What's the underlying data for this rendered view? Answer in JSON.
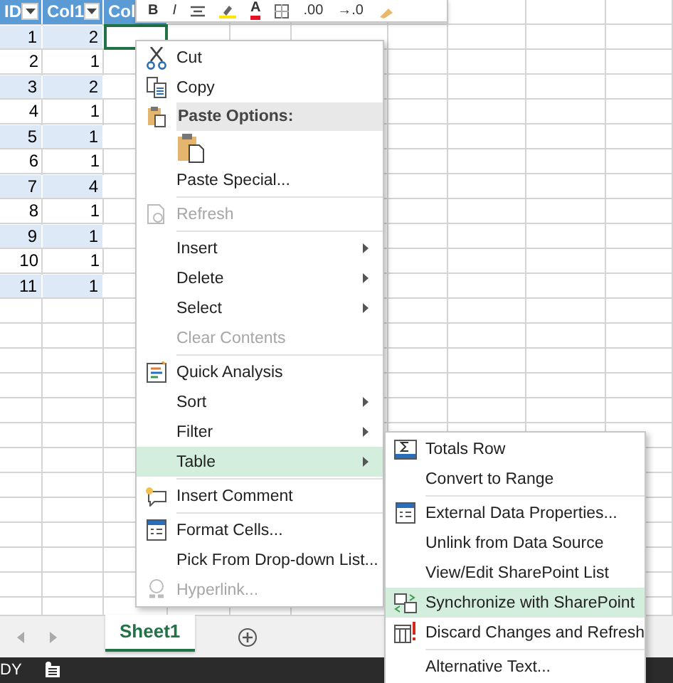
{
  "toolbar": [
    {
      "kind": "text",
      "text": "B"
    },
    {
      "kind": "text",
      "text": "I"
    },
    {
      "kind": "icon"
    },
    {
      "kind": "icon"
    },
    {
      "kind": "color-text",
      "text": "A"
    },
    {
      "kind": "icon"
    },
    {
      "kind": "text",
      "text": ".00"
    },
    {
      "kind": "text",
      "text": "→.0"
    },
    {
      "kind": "icon"
    }
  ],
  "table": {
    "columns": [
      {
        "label": "ID",
        "filter": true
      },
      {
        "label": "Col1",
        "filter": true
      },
      {
        "label": "Col"
      }
    ],
    "rows": [
      [
        "1",
        "2"
      ],
      [
        "2",
        "1"
      ],
      [
        "3",
        "2"
      ],
      [
        "4",
        "1"
      ],
      [
        "5",
        "1"
      ],
      [
        "6",
        "1"
      ],
      [
        "7",
        "4"
      ],
      [
        "8",
        "1"
      ],
      [
        "9",
        "1"
      ],
      [
        "10",
        "1"
      ],
      [
        "11",
        "1"
      ]
    ]
  },
  "context_menu": [
    {
      "kind": "item",
      "label": "Cut",
      "disabled": false,
      "submenu": false,
      "selected": false
    },
    {
      "kind": "item",
      "label": "Copy",
      "disabled": false,
      "submenu": false,
      "selected": false
    },
    {
      "kind": "header",
      "label": "Paste Options:"
    },
    {
      "kind": "paste-option"
    },
    {
      "kind": "item",
      "label": "Paste Special...",
      "disabled": false,
      "submenu": false,
      "selected": false
    },
    {
      "kind": "separator"
    },
    {
      "kind": "item",
      "label": "Refresh",
      "disabled": true,
      "submenu": false,
      "selected": false
    },
    {
      "kind": "separator"
    },
    {
      "kind": "item",
      "label": "Insert",
      "disabled": false,
      "submenu": true,
      "selected": false
    },
    {
      "kind": "item",
      "label": "Delete",
      "disabled": false,
      "submenu": true,
      "selected": false
    },
    {
      "kind": "item",
      "label": "Select",
      "disabled": false,
      "submenu": true,
      "selected": false
    },
    {
      "kind": "item",
      "label": "Clear Contents",
      "disabled": true,
      "submenu": false,
      "selected": false
    },
    {
      "kind": "separator"
    },
    {
      "kind": "item",
      "label": "Quick Analysis",
      "disabled": false,
      "submenu": false,
      "selected": false
    },
    {
      "kind": "item",
      "label": "Sort",
      "disabled": false,
      "submenu": true,
      "selected": false
    },
    {
      "kind": "item",
      "label": "Filter",
      "disabled": false,
      "submenu": true,
      "selected": false
    },
    {
      "kind": "item",
      "label": "Table",
      "disabled": false,
      "submenu": true,
      "selected": true
    },
    {
      "kind": "separator"
    },
    {
      "kind": "item",
      "label": "Insert Comment",
      "disabled": false,
      "submenu": false,
      "selected": false
    },
    {
      "kind": "separator"
    },
    {
      "kind": "item",
      "label": "Format Cells...",
      "disabled": false,
      "submenu": false,
      "selected": false
    },
    {
      "kind": "item",
      "label": "Pick From Drop-down List...",
      "disabled": false,
      "submenu": false,
      "selected": false
    },
    {
      "kind": "item",
      "label": "Hyperlink...",
      "disabled": true,
      "submenu": false,
      "selected": false
    }
  ],
  "table_submenu": [
    {
      "kind": "item",
      "label": "Totals Row",
      "selected": false
    },
    {
      "kind": "item",
      "label": "Convert to Range",
      "selected": false
    },
    {
      "kind": "separator"
    },
    {
      "kind": "item",
      "label": "External Data Properties...",
      "selected": false
    },
    {
      "kind": "item",
      "label": "Unlink from Data Source",
      "selected": false
    },
    {
      "kind": "item",
      "label": "View/Edit SharePoint List",
      "selected": false
    },
    {
      "kind": "item",
      "label": "Synchronize with SharePoint",
      "selected": true
    },
    {
      "kind": "item",
      "label": "Discard Changes and Refresh",
      "selected": false
    },
    {
      "kind": "separator"
    },
    {
      "kind": "item",
      "label": "Alternative Text...",
      "selected": false
    }
  ],
  "sheet_tabs": [
    {
      "label": "Sheet1",
      "selected": true
    }
  ],
  "status_bar": {
    "mode": "DY"
  }
}
